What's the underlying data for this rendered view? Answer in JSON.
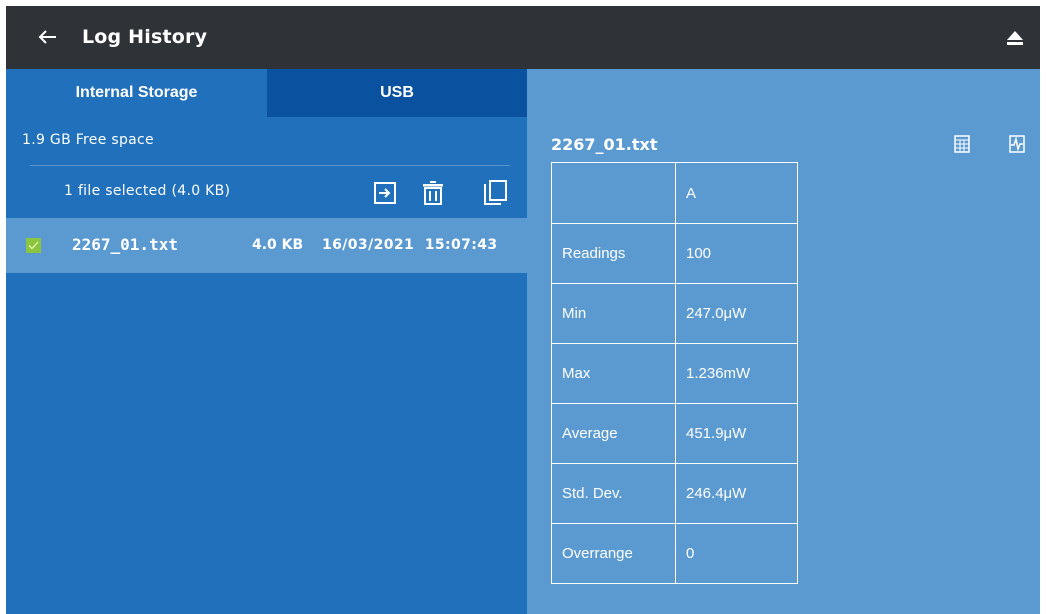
{
  "header": {
    "title": "Log History",
    "back_icon": "arrow-left-icon",
    "eject_icon": "eject-icon"
  },
  "storage": {
    "tabs": [
      {
        "label": "Internal Storage",
        "active": true
      },
      {
        "label": "USB",
        "active": false
      }
    ],
    "free_space": "1.9 GB Free space",
    "selection_summary": "1 file selected (4.0 KB)",
    "actions": [
      "export-icon",
      "delete-icon",
      "copy-icon"
    ],
    "files": [
      {
        "name": "2267_01.txt",
        "size": "4.0 KB",
        "date": "16/03/2021  15:07:43",
        "checked": true
      }
    ]
  },
  "detail": {
    "file_name": "2267_01.txt",
    "icons": [
      "table-view-icon",
      "graph-view-icon"
    ],
    "column_header": "A",
    "rows": [
      {
        "label": "Readings",
        "value": "100"
      },
      {
        "label": "Min",
        "value": "247.0μW"
      },
      {
        "label": "Max",
        "value": "1.236mW"
      },
      {
        "label": "Average",
        "value": "451.9μW"
      },
      {
        "label": "Std. Dev.",
        "value": "246.4μW"
      },
      {
        "label": "Overrange",
        "value": "0"
      }
    ]
  },
  "colors": {
    "topbar": "#2f3337",
    "left_panel": "#2070bb",
    "usb_tab": "#0a51a0",
    "right_panel": "#5b9ad1",
    "checkbox": "#8bc53f"
  }
}
